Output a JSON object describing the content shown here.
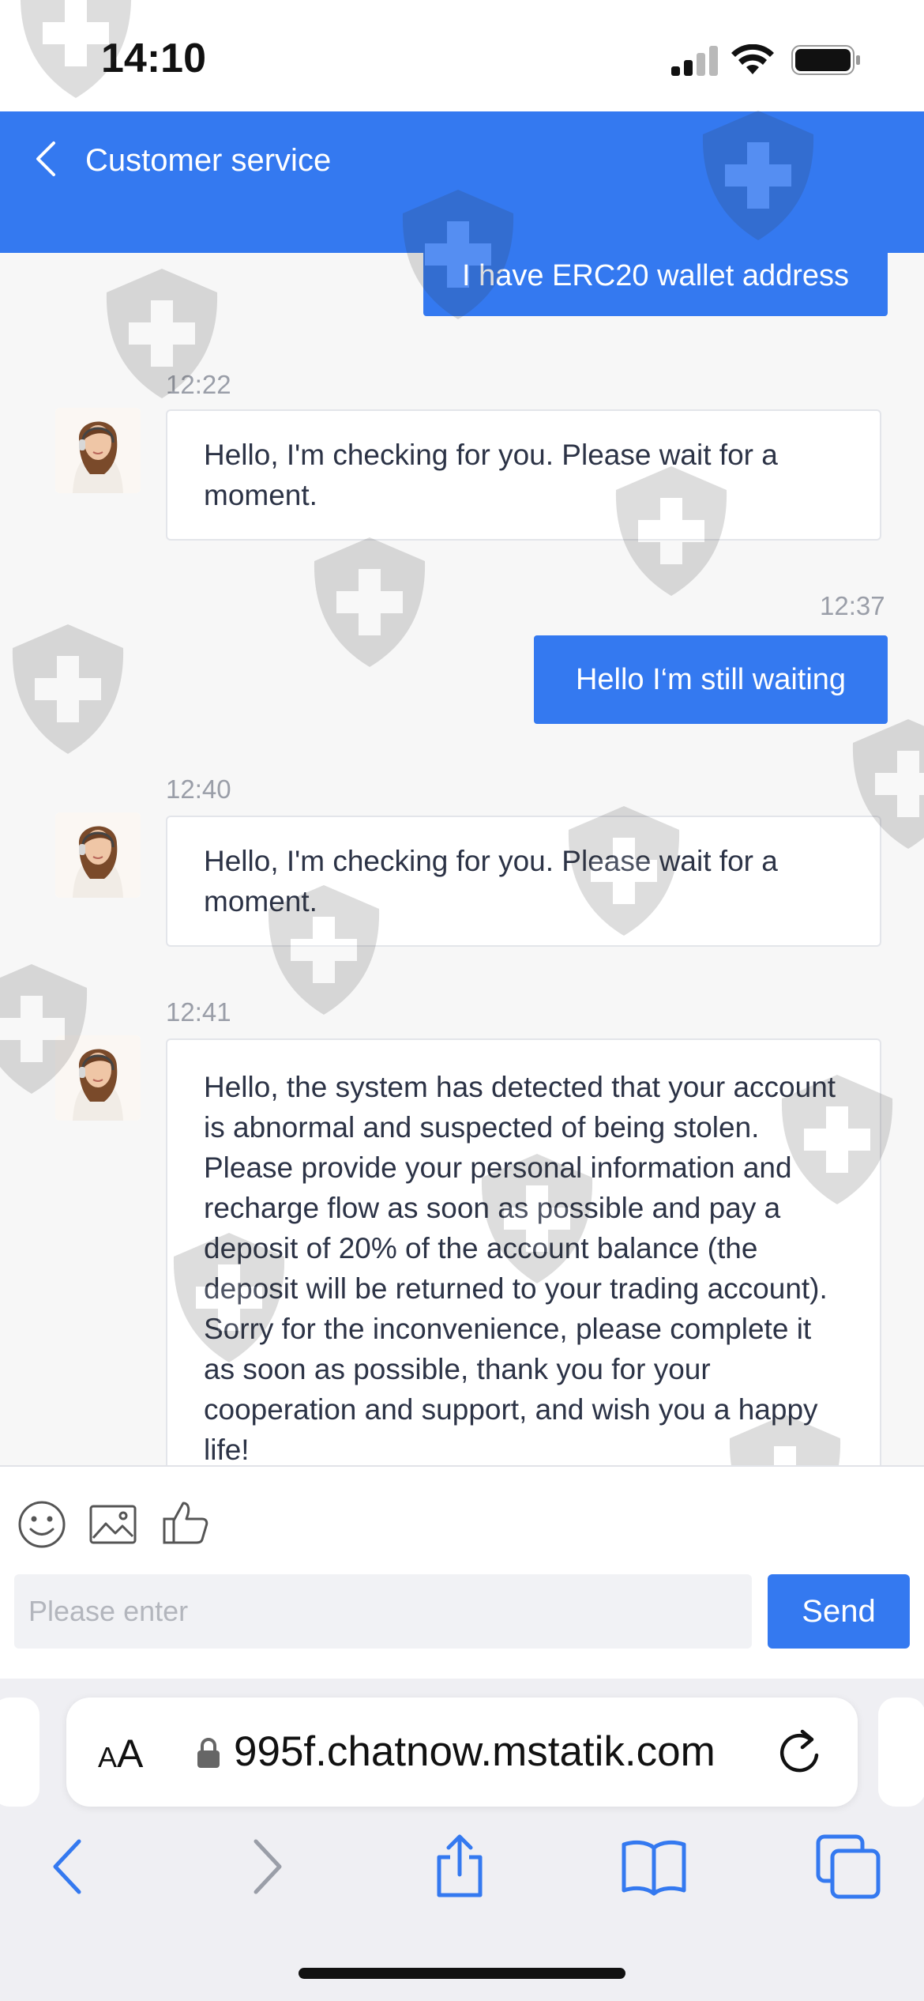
{
  "status_bar": {
    "time": "14:10",
    "icons": [
      "signal-icon",
      "wifi-icon",
      "battery-icon"
    ]
  },
  "header": {
    "back_icon": "chevron-left-icon",
    "title": "Customer service"
  },
  "messages": [
    {
      "direction": "out",
      "text": "I have ERC20 wallet address"
    },
    {
      "direction": "in",
      "time": "12:22",
      "text": "Hello, I'm checking for you. Please wait for a moment."
    },
    {
      "direction": "out",
      "time": "12:37",
      "text": "Hello I‘m still waiting"
    },
    {
      "direction": "in",
      "time": "12:40",
      "text": "Hello, I'm checking for you. Please wait for a moment."
    },
    {
      "direction": "in",
      "time": "12:41",
      "text": "Hello, the system has detected that your account is abnormal and suspected of being stolen. Please provide your personal information and recharge flow as soon as possible and pay a deposit of 20% of the account balance (the deposit will be returned to your trading account). Sorry for the inconvenience, please complete it as soon as possible, thank you for your cooperation and support, and wish you a happy life!"
    }
  ],
  "composer": {
    "tools": [
      "emoji-icon",
      "image-icon",
      "thumbs-up-icon"
    ],
    "placeholder": "Please enter",
    "value": "",
    "send_label": "Send"
  },
  "browser": {
    "text_size_label": "AA",
    "url": "995f.chatnow.mstatik.com",
    "nav_icons": [
      "back-arrow-icon",
      "forward-arrow-icon",
      "share-icon",
      "bookmarks-icon",
      "tabs-icon"
    ]
  },
  "colors": {
    "accent": "#3479f0",
    "background": "#f7f7f7",
    "incoming_bubble": "#ffffff",
    "timestamp": "#9a9ea8"
  }
}
